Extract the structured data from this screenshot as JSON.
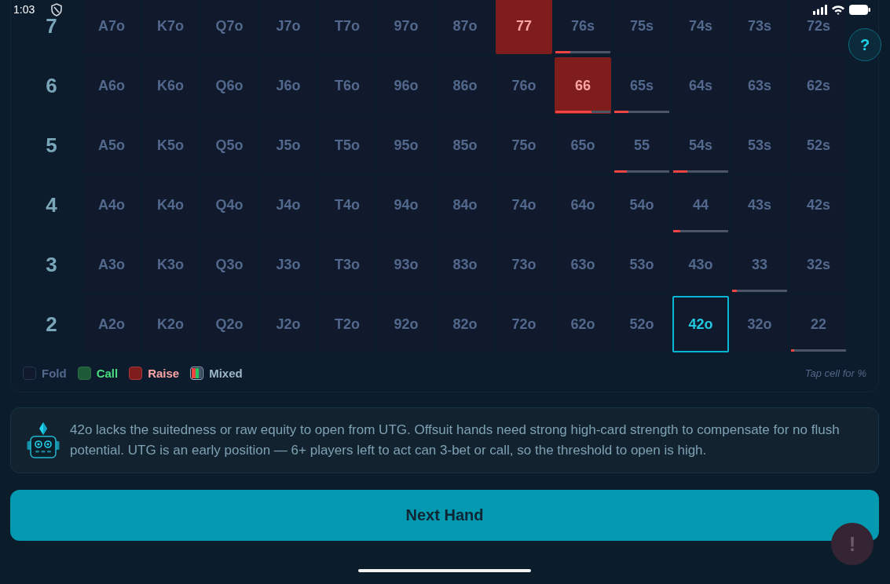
{
  "status_bar": {
    "time": "1:03"
  },
  "help_button": {
    "label": "?"
  },
  "range_grid": {
    "rows": [
      {
        "rank": "7",
        "cells": [
          {
            "label": "A7o",
            "kind": "fold",
            "selected": false
          },
          {
            "label": "K7o",
            "kind": "fold",
            "selected": false
          },
          {
            "label": "Q7o",
            "kind": "fold",
            "selected": false
          },
          {
            "label": "J7o",
            "kind": "fold",
            "selected": false
          },
          {
            "label": "T7o",
            "kind": "fold",
            "selected": false
          },
          {
            "label": "97o",
            "kind": "fold",
            "selected": false
          },
          {
            "label": "87o",
            "kind": "fold",
            "selected": false
          },
          {
            "label": "77",
            "kind": "raise",
            "selected": false
          },
          {
            "label": "76s",
            "kind": "fold",
            "selected": false,
            "level": 0.27
          },
          {
            "label": "75s",
            "kind": "fold",
            "selected": false
          },
          {
            "label": "74s",
            "kind": "fold",
            "selected": false
          },
          {
            "label": "73s",
            "kind": "fold",
            "selected": false
          },
          {
            "label": "72s",
            "kind": "fold",
            "selected": false
          }
        ]
      },
      {
        "rank": "6",
        "cells": [
          {
            "label": "A6o",
            "kind": "fold",
            "selected": false
          },
          {
            "label": "K6o",
            "kind": "fold",
            "selected": false
          },
          {
            "label": "Q6o",
            "kind": "fold",
            "selected": false
          },
          {
            "label": "J6o",
            "kind": "fold",
            "selected": false
          },
          {
            "label": "T6o",
            "kind": "fold",
            "selected": false
          },
          {
            "label": "96o",
            "kind": "fold",
            "selected": false
          },
          {
            "label": "86o",
            "kind": "fold",
            "selected": false
          },
          {
            "label": "76o",
            "kind": "fold",
            "selected": false
          },
          {
            "label": "66",
            "kind": "raise",
            "selected": false,
            "level": 0.65
          },
          {
            "label": "65s",
            "kind": "fold",
            "selected": false,
            "level": 0.25
          },
          {
            "label": "64s",
            "kind": "fold",
            "selected": false
          },
          {
            "label": "63s",
            "kind": "fold",
            "selected": false
          },
          {
            "label": "62s",
            "kind": "fold",
            "selected": false
          }
        ]
      },
      {
        "rank": "5",
        "cells": [
          {
            "label": "A5o",
            "kind": "fold",
            "selected": false
          },
          {
            "label": "K5o",
            "kind": "fold",
            "selected": false
          },
          {
            "label": "Q5o",
            "kind": "fold",
            "selected": false
          },
          {
            "label": "J5o",
            "kind": "fold",
            "selected": false
          },
          {
            "label": "T5o",
            "kind": "fold",
            "selected": false
          },
          {
            "label": "95o",
            "kind": "fold",
            "selected": false
          },
          {
            "label": "85o",
            "kind": "fold",
            "selected": false
          },
          {
            "label": "75o",
            "kind": "fold",
            "selected": false
          },
          {
            "label": "65o",
            "kind": "fold",
            "selected": false
          },
          {
            "label": "55",
            "kind": "fold",
            "selected": false,
            "level": 0.23
          },
          {
            "label": "54s",
            "kind": "fold",
            "selected": false,
            "level": 0.25
          },
          {
            "label": "53s",
            "kind": "fold",
            "selected": false
          },
          {
            "label": "52s",
            "kind": "fold",
            "selected": false
          }
        ]
      },
      {
        "rank": "4",
        "cells": [
          {
            "label": "A4o",
            "kind": "fold",
            "selected": false
          },
          {
            "label": "K4o",
            "kind": "fold",
            "selected": false
          },
          {
            "label": "Q4o",
            "kind": "fold",
            "selected": false
          },
          {
            "label": "J4o",
            "kind": "fold",
            "selected": false
          },
          {
            "label": "T4o",
            "kind": "fold",
            "selected": false
          },
          {
            "label": "94o",
            "kind": "fold",
            "selected": false
          },
          {
            "label": "84o",
            "kind": "fold",
            "selected": false
          },
          {
            "label": "74o",
            "kind": "fold",
            "selected": false
          },
          {
            "label": "64o",
            "kind": "fold",
            "selected": false
          },
          {
            "label": "54o",
            "kind": "fold",
            "selected": false
          },
          {
            "label": "44",
            "kind": "fold",
            "selected": false,
            "level": 0.13
          },
          {
            "label": "43s",
            "kind": "fold",
            "selected": false
          },
          {
            "label": "42s",
            "kind": "fold",
            "selected": false
          }
        ]
      },
      {
        "rank": "3",
        "cells": [
          {
            "label": "A3o",
            "kind": "fold",
            "selected": false
          },
          {
            "label": "K3o",
            "kind": "fold",
            "selected": false
          },
          {
            "label": "Q3o",
            "kind": "fold",
            "selected": false
          },
          {
            "label": "J3o",
            "kind": "fold",
            "selected": false
          },
          {
            "label": "T3o",
            "kind": "fold",
            "selected": false
          },
          {
            "label": "93o",
            "kind": "fold",
            "selected": false
          },
          {
            "label": "83o",
            "kind": "fold",
            "selected": false
          },
          {
            "label": "73o",
            "kind": "fold",
            "selected": false
          },
          {
            "label": "63o",
            "kind": "fold",
            "selected": false
          },
          {
            "label": "53o",
            "kind": "fold",
            "selected": false
          },
          {
            "label": "43o",
            "kind": "fold",
            "selected": false
          },
          {
            "label": "33",
            "kind": "fold",
            "selected": false,
            "level": 0.08
          },
          {
            "label": "32s",
            "kind": "fold",
            "selected": false
          }
        ]
      },
      {
        "rank": "2",
        "cells": [
          {
            "label": "A2o",
            "kind": "fold",
            "selected": false
          },
          {
            "label": "K2o",
            "kind": "fold",
            "selected": false
          },
          {
            "label": "Q2o",
            "kind": "fold",
            "selected": false
          },
          {
            "label": "J2o",
            "kind": "fold",
            "selected": false
          },
          {
            "label": "T2o",
            "kind": "fold",
            "selected": false
          },
          {
            "label": "92o",
            "kind": "fold",
            "selected": false
          },
          {
            "label": "82o",
            "kind": "fold",
            "selected": false
          },
          {
            "label": "72o",
            "kind": "fold",
            "selected": false
          },
          {
            "label": "62o",
            "kind": "fold",
            "selected": false
          },
          {
            "label": "52o",
            "kind": "fold",
            "selected": false
          },
          {
            "label": "42o",
            "kind": "fold",
            "selected": true
          },
          {
            "label": "32o",
            "kind": "fold",
            "selected": false
          },
          {
            "label": "22",
            "kind": "fold",
            "selected": false,
            "level": 0.06
          }
        ]
      }
    ],
    "legend": [
      {
        "kind": "fold",
        "label": "Fold"
      },
      {
        "kind": "call",
        "label": "Call"
      },
      {
        "kind": "raise",
        "label": "Raise"
      },
      {
        "kind": "mixed",
        "label": "Mixed"
      }
    ],
    "hint": "Tap cell for %"
  },
  "explanation": {
    "text": "42o lacks the suitedness or raw equity to open from UTG. Offsuit hands need strong high-card strength to compensate for no flush potential. UTG is an early position — 6+ players left to act can 3-bet or call, so the threshold to open is high."
  },
  "next_button": {
    "label": "Next Hand"
  },
  "feedback_button": {
    "label": "!"
  }
}
